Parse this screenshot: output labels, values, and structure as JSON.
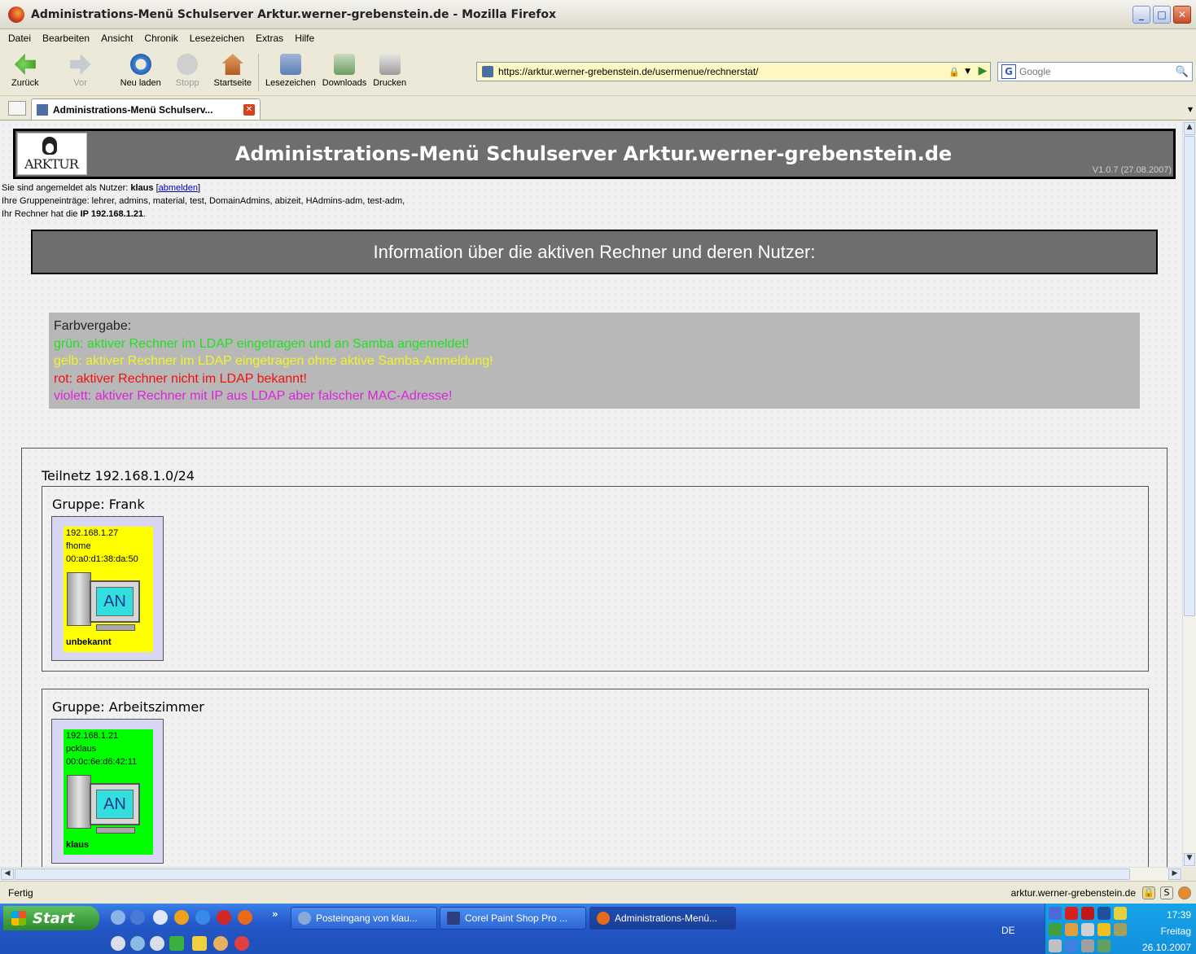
{
  "window": {
    "title": "Administrations-Menü Schulserver Arktur.werner-grebenstein.de - Mozilla Firefox"
  },
  "menubar": [
    "Datei",
    "Bearbeiten",
    "Ansicht",
    "Chronik",
    "Lesezeichen",
    "Extras",
    "Hilfe"
  ],
  "toolbar": {
    "back": "Zurück",
    "forward": "Vor",
    "reload": "Neu laden",
    "stop": "Stopp",
    "home": "Startseite",
    "bookmarks": "Lesezeichen",
    "downloads": "Downloads",
    "print": "Drucken",
    "url": "https://arktur.werner-grebenstein.de/usermenue/rechnerstat/",
    "search_placeholder": "Google"
  },
  "tab": {
    "title": "Administrations-Menü Schulserv..."
  },
  "page": {
    "header_title": "Administrations-Menü Schulserver Arktur.werner-grebenstein.de",
    "logo_text": "ARKTUR",
    "version": "V1.0.7 (27.08.2007)",
    "user_prefix": "Sie sind angemeldet als Nutzer: ",
    "user_name": "klaus",
    "logout_open": " [",
    "logout_link": "abmelden",
    "logout_close": "]",
    "groups_line": "Ihre Gruppeneinträge: lehrer, admins, material, test, DomainAdmins, abizeit, HAdmins-adm, test-adm,",
    "ip_prefix": "Ihr Rechner hat die ",
    "ip_value": "IP 192.168.1.21",
    "ip_suffix": ".",
    "banner": "Information über die aktiven Rechner und deren Nutzer:",
    "legend": {
      "title": "Farbvergabe:",
      "green": "grün: aktiver Rechner im LDAP eingetragen und an Samba angemeldet!",
      "yellow": "gelb: aktiver Rechner im LDAP eingetragen ohne aktive Samba-Anmeldung!",
      "red": "rot: aktiver Rechner nicht im LDAP bekannt!",
      "violet": "violett: aktiver Rechner mit IP aus LDAP aber falscher MAC-Adresse!"
    },
    "subnet_title": "Teilnetz 192.168.1.0/24",
    "groups": [
      {
        "title": "Gruppe: Frank",
        "host": {
          "ip": "192.168.1.27",
          "name": "fhome",
          "mac": "00:a0:d1:38:da:50",
          "screen": "AN",
          "user": "unbekannt",
          "color": "#ffff00"
        }
      },
      {
        "title": "Gruppe: Arbeitszimmer",
        "host": {
          "ip": "192.168.1.21",
          "name": "pcklaus",
          "mac": "00:0c:6e:d6:42:11",
          "screen": "AN",
          "user": "klaus",
          "color": "#00ff00"
        }
      }
    ]
  },
  "statusbar": {
    "status": "Fertig",
    "host": "arktur.werner-grebenstein.de"
  },
  "taskbar": {
    "start": "Start",
    "tasks": [
      "Posteingang von klau...",
      "Corel Paint Shop Pro ...",
      "Administrations-Menü..."
    ],
    "lang": "DE",
    "time": "17:39",
    "day": "Freitag",
    "date": "26.10.2007"
  }
}
